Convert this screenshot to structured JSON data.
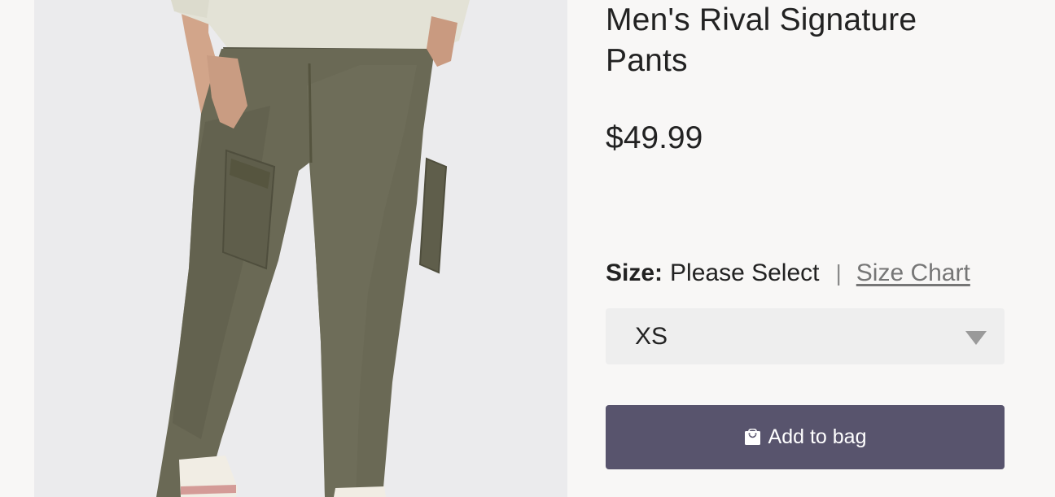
{
  "product": {
    "title": "Men's Rival Signature Pants",
    "price": "$49.99",
    "image": {
      "icon": "product-photo-pants",
      "background_color": "#ebebed"
    }
  },
  "size": {
    "label": "Size:",
    "value": "Please Select",
    "divider": "|",
    "chart_link": "Size Chart",
    "selected_option": "XS"
  },
  "actions": {
    "add_to_bag_label": "Add to bag",
    "add_to_bag_icon": "shopping-bag-icon",
    "button_color": "#58546d"
  }
}
